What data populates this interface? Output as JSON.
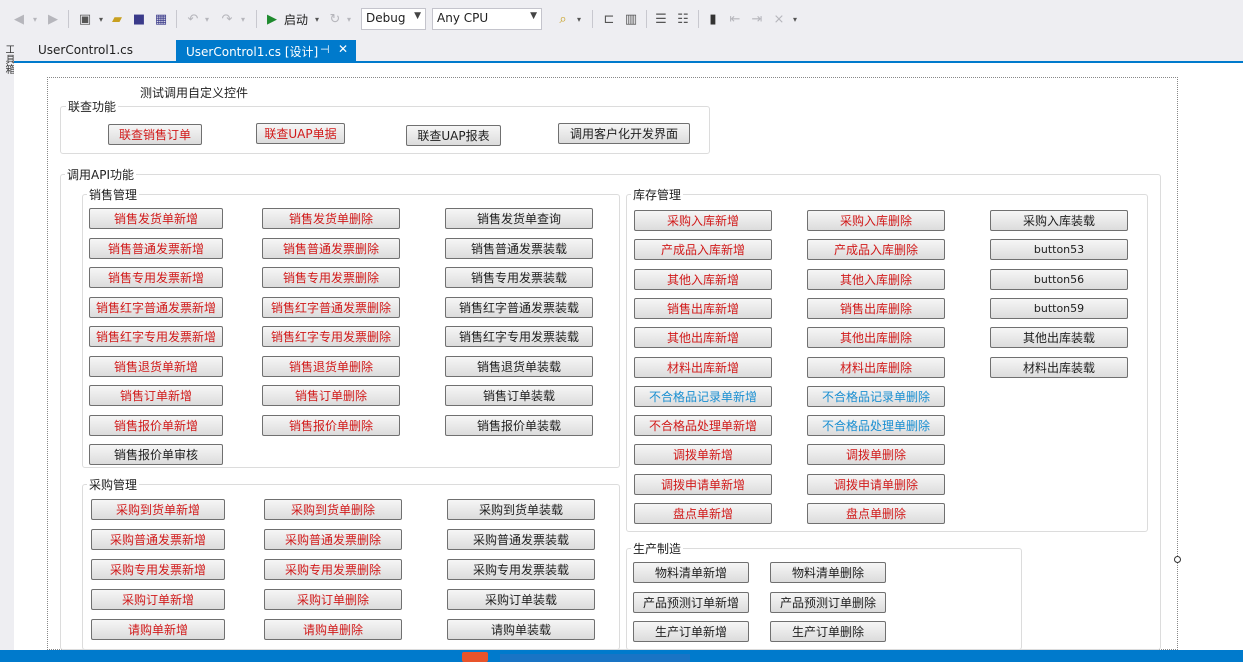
{
  "toolbar": {
    "start_label": "启动",
    "config_value": "Debug",
    "platform_value": "Any CPU"
  },
  "toolbox": {
    "label": "工具箱"
  },
  "tabs": [
    {
      "label": "UserControl1.cs"
    },
    {
      "label": "UserControl1.cs [设计]"
    }
  ],
  "header_label": "测试调用自定义控件",
  "link_group": {
    "title": "联查功能",
    "buttons": [
      {
        "label": "联查销售订单",
        "color": "red"
      },
      {
        "label": "联查UAP单据",
        "color": "red"
      },
      {
        "label": "联查UAP报表",
        "color": "black"
      },
      {
        "label": "调用客户化开发界面",
        "color": "black"
      }
    ]
  },
  "api_group": {
    "title": "调用API功能"
  },
  "sales": {
    "title": "销售管理",
    "rows": [
      [
        "销售发货单新增",
        "销售发货单删除",
        "销售发货单查询"
      ],
      [
        "销售普通发票新增",
        "销售普通发票删除",
        "销售普通发票装载"
      ],
      [
        "销售专用发票新增",
        "销售专用发票删除",
        "销售专用发票装载"
      ],
      [
        "销售红字普通发票新增",
        "销售红字普通发票删除",
        "销售红字普通发票装载"
      ],
      [
        "销售红字专用发票新增",
        "销售红字专用发票删除",
        "销售红字专用发票装载"
      ],
      [
        "销售退货单新增",
        "销售退货单删除",
        "销售退货单装载"
      ],
      [
        "销售订单新增",
        "销售订单删除",
        "销售订单装载"
      ],
      [
        "销售报价单新增",
        "销售报价单删除",
        "销售报价单装载"
      ],
      [
        "销售报价单审核"
      ]
    ]
  },
  "purchase": {
    "title": "采购管理",
    "rows": [
      [
        "采购到货单新增",
        "采购到货单删除",
        "采购到货单装载"
      ],
      [
        "采购普通发票新增",
        "采购普通发票删除",
        "采购普通发票装载"
      ],
      [
        "采购专用发票新增",
        "采购专用发票删除",
        "采购专用发票装载"
      ],
      [
        "采购订单新增",
        "采购订单删除",
        "采购订单装载"
      ],
      [
        "请购单新增",
        "请购单删除",
        "请购单装载"
      ]
    ]
  },
  "inventory": {
    "title": "库存管理",
    "rows": [
      [
        "采购入库新增",
        "采购入库删除",
        "采购入库装载"
      ],
      [
        "产成品入库新增",
        "产成品入库删除",
        "button53"
      ],
      [
        "其他入库新增",
        "其他入库删除",
        "button56"
      ],
      [
        "销售出库新增",
        "销售出库删除",
        "button59"
      ],
      [
        "其他出库新增",
        "其他出库删除",
        "其他出库装载"
      ],
      [
        "材料出库新增",
        "材料出库删除",
        "材料出库装载"
      ],
      [
        "不合格品记录单新增",
        "不合格品记录单删除"
      ],
      [
        "不合格品处理单新增",
        "不合格品处理单删除"
      ],
      [
        "调拨单新增",
        "调拨单删除"
      ],
      [
        "调拨申请单新增",
        "调拨申请单删除"
      ],
      [
        "盘点单新增",
        "盘点单删除"
      ]
    ]
  },
  "production": {
    "title": "生产制造",
    "rows": [
      [
        "物料清单新增",
        "物料清单删除"
      ],
      [
        "产品预测订单新增",
        "产品预测订单删除"
      ],
      [
        "生产订单新增",
        "生产订单删除"
      ]
    ]
  }
}
